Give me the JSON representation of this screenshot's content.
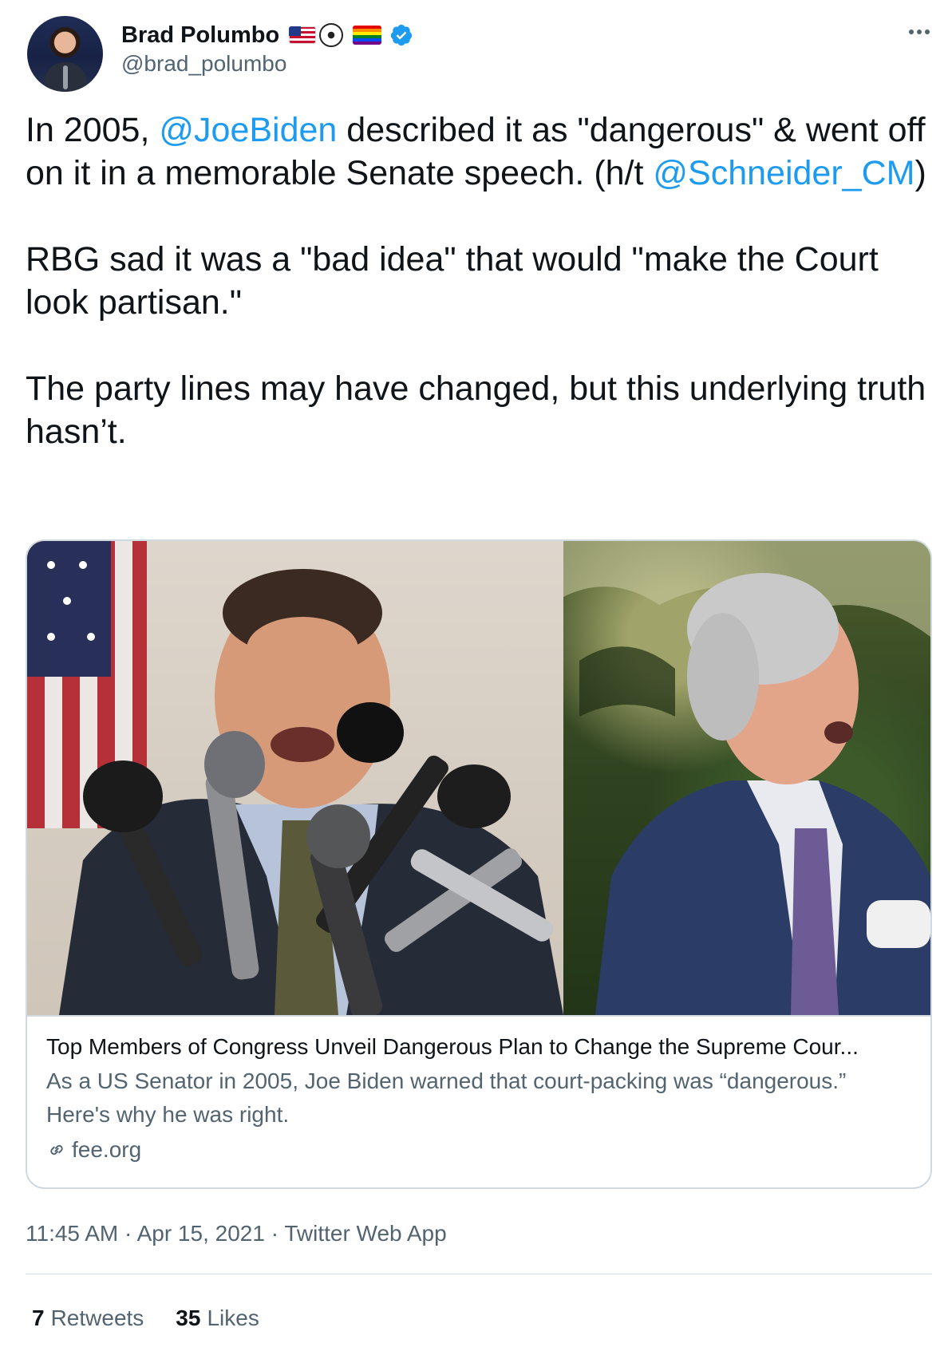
{
  "author": {
    "name": "Brad Polumbo",
    "handle": "@brad_polumbo",
    "emojis": [
      "us-flag-emoji",
      "soccer-ball-emoji",
      "rainbow-flag-emoji"
    ],
    "verified": true
  },
  "tweet": {
    "paragraphs": [
      {
        "segments": [
          {
            "text": "In 2005, ",
            "type": "text"
          },
          {
            "text": "@JoeBiden",
            "type": "mention"
          },
          {
            "text": " described it as \"dangerous\" & went off on it in a memorable Senate speech. (h/t ",
            "type": "text"
          },
          {
            "text": "@Schneider_CM",
            "type": "mention"
          },
          {
            "text": ")",
            "type": "text"
          }
        ]
      },
      {
        "segments": [
          {
            "text": "RBG sad it was a \"bad idea\" that would \"make the Court look partisan.\"",
            "type": "text"
          }
        ]
      },
      {
        "segments": [
          {
            "text": "The party lines may have changed, but this underlying truth hasn’t.",
            "type": "text"
          }
        ]
      }
    ]
  },
  "card": {
    "title": "Top Members of Congress Unveil Dangerous Plan to Change the Supreme Cour...",
    "description": "As a US Senator in 2005, Joe Biden warned that court-packing was “dangerous.” Here's why he was right.",
    "domain": "fee.org"
  },
  "meta": {
    "time": "11:45 AM",
    "date": "Apr 15, 2021",
    "source": "Twitter Web App",
    "separator": " · "
  },
  "stats": {
    "retweets_count": "7",
    "retweets_label": "Retweets",
    "likes_count": "35",
    "likes_label": "Likes"
  },
  "colors": {
    "link": "#1d9bf0",
    "secondary_text": "#536471",
    "border": "#cfd9de",
    "primary_text": "#0f1419"
  }
}
